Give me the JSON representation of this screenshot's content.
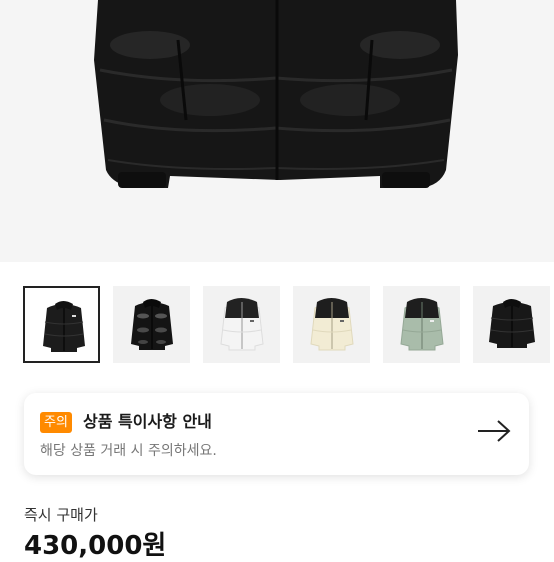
{
  "product": {
    "main_image": "black puffer down jacket (cropped)",
    "thumbnails": [
      {
        "alt": "black matte puffer jacket",
        "selected": true
      },
      {
        "alt": "black glossy puffer jacket",
        "selected": false
      },
      {
        "alt": "white and black puffer jacket",
        "selected": false
      },
      {
        "alt": "cream and black puffer jacket",
        "selected": false
      },
      {
        "alt": "sage green and black puffer jacket",
        "selected": false
      },
      {
        "alt": "black puffer jacket",
        "selected": false
      }
    ]
  },
  "notice": {
    "badge": "주의",
    "title": "상품 특이사항 안내",
    "description": "해당 상품 거래 시 주의하세요.",
    "arrow_icon": "arrow-right-icon"
  },
  "price": {
    "label": "즉시 구매가",
    "value": "430,000원"
  },
  "colors": {
    "badge": "#ff8a00",
    "jacket_black": "#1c1c1c",
    "jacket_white": "#f4f4f4",
    "jacket_cream": "#f2ecd4",
    "jacket_sage": "#a9bcaa"
  }
}
